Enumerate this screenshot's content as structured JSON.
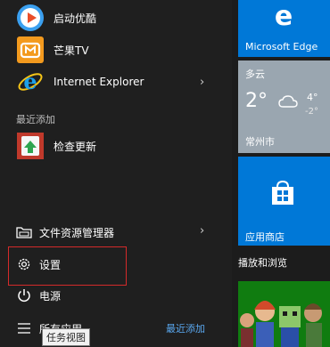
{
  "apps": [
    {
      "label": "启动优酷",
      "icon": "youku-icon"
    },
    {
      "label": "芒果TV",
      "icon": "mango-tv-icon"
    },
    {
      "label": "Internet Explorer",
      "icon": "ie-icon",
      "expand": "›"
    }
  ],
  "recent": {
    "title": "最近添加",
    "items": [
      {
        "label": "检查更新",
        "icon": "update-check-icon"
      }
    ]
  },
  "system": {
    "file_explorer": "文件资源管理器",
    "file_explorer_expand": "›",
    "settings": "设置",
    "power": "电源",
    "all_apps": "所有应用",
    "recently_added": "最近添加"
  },
  "tooltip": "任务视图",
  "tiles": {
    "edge": {
      "label": "Microsoft Edge"
    },
    "weather": {
      "condition": "多云",
      "temp": "2°",
      "high": "4°",
      "low": "-2°",
      "city": "常州市"
    },
    "store": {
      "label": "应用商店"
    },
    "play_group": "播放和浏览"
  },
  "colors": {
    "accent": "#0078d7",
    "highlight_border": "#d42a2a",
    "weather_bg": "#9aa6b0"
  }
}
